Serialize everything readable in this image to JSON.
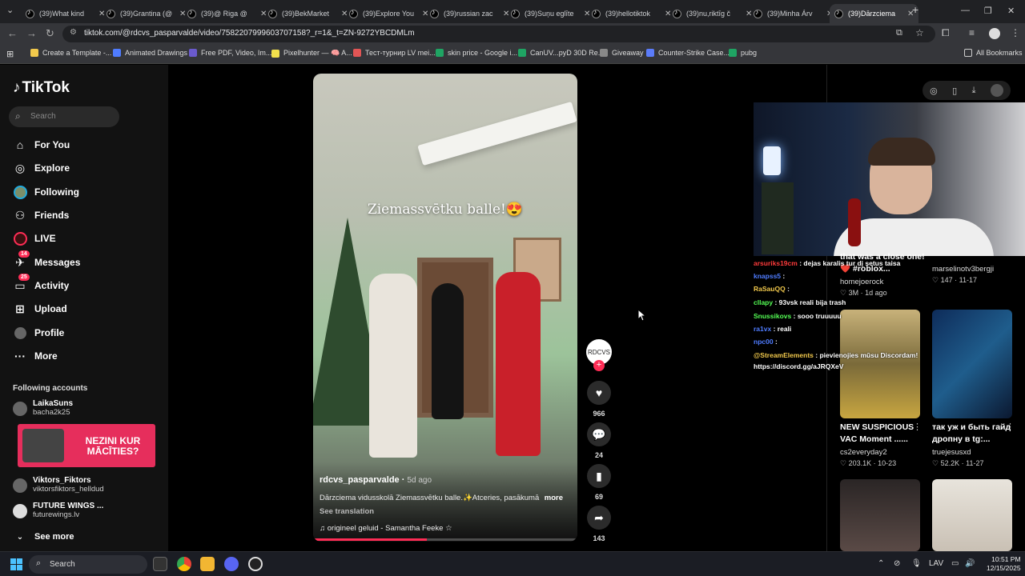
{
  "browser": {
    "tabs": [
      {
        "label": "(39)What kind"
      },
      {
        "label": "(39)Grantina (@"
      },
      {
        "label": "(39)@ Riga @"
      },
      {
        "label": "(39)BekMarket"
      },
      {
        "label": "(39)Explore You"
      },
      {
        "label": "(39)russian zac"
      },
      {
        "label": "(39)Suņu eglīte"
      },
      {
        "label": "(39)hellotiktok"
      },
      {
        "label": "(39)nu,riktīg č"
      },
      {
        "label": "(39)Minha Árv"
      },
      {
        "label": "(39)Dārzciema"
      }
    ],
    "new_tab": "+",
    "url": "tiktok.com/@rdcvs_pasparvalde/video/7582207999603707158?_r=1&_t=ZN-9272YBCDMLm",
    "bookmarks": [
      {
        "label": "Create a Template -...",
        "color": "#f2c94c"
      },
      {
        "label": "Animated Drawings",
        "color": "#4f7cff"
      },
      {
        "label": "Free PDF, Video, Im...",
        "color": "#6a5acd"
      },
      {
        "label": "Pixelhunter — 🧠 A...",
        "color": "#f2e14c"
      },
      {
        "label": "Тест-турнир LV mei...",
        "color": "#e25555"
      },
      {
        "label": "skin price - Google i...",
        "color": "#1fa463"
      },
      {
        "label": "CanUV...pyD 30D Re...",
        "color": "#1fa463"
      },
      {
        "label": "Giveaway",
        "color": "#888888"
      },
      {
        "label": "Counter-Strike Case...",
        "color": "#5b7cfa"
      },
      {
        "label": "pubg",
        "color": "#1fa463"
      }
    ],
    "all_bookmarks": "All Bookmarks"
  },
  "sidebar": {
    "logo": "TikTok",
    "search_placeholder": "Search",
    "nav": [
      {
        "label": "For You",
        "icon": "home-icon"
      },
      {
        "label": "Explore",
        "icon": "compass-icon"
      },
      {
        "label": "Following",
        "icon": "following-avatar-icon"
      },
      {
        "label": "Friends",
        "icon": "friends-icon"
      },
      {
        "label": "LIVE",
        "icon": "live-icon"
      },
      {
        "label": "Messages",
        "icon": "messages-icon",
        "badge": "14"
      },
      {
        "label": "Activity",
        "icon": "activity-icon",
        "badge": "25"
      },
      {
        "label": "Upload",
        "icon": "upload-icon"
      },
      {
        "label": "Profile",
        "icon": "profile-icon"
      },
      {
        "label": "More",
        "icon": "more-icon"
      }
    ],
    "following_header": "Following accounts",
    "accounts": [
      {
        "name": "LaikaSuns",
        "handle": "bacha2k25"
      },
      {
        "name": "Viktors_Fiktors",
        "handle": "viktorsfiktors_helldud"
      },
      {
        "name": "FUTURE WINGS ...",
        "handle": "futurewings.lv"
      }
    ],
    "ad_text": "NEZINI KUR MĀCĪTIES?",
    "see_more": "See more"
  },
  "video": {
    "overlay_text": "Ziemassvētku balle!😍",
    "author": "rdcvs_pasparvalde",
    "age": "5d ago",
    "description": "Dārzciema vidusskolā Ziemassvētku balle.✨Atceries, pasākumā",
    "more": "more",
    "see_translation": "See translation",
    "music": "origineel geluid - Samantha Feeke ☆",
    "progress_fraction": 0.43,
    "likes": "966",
    "comments": "24",
    "saves": "69",
    "shares": "143",
    "creator_avatar_text": "RDCVS",
    "follow_plus": "+"
  },
  "live": {
    "chat": [
      {
        "user": "arsuriks19cm",
        "text": ": dejas karalis tur dį setus taisa",
        "color": "#ff3b3b"
      },
      {
        "user": "knapss5",
        "text": ":",
        "color": "#4f7cff"
      },
      {
        "user": "RaSauQQ",
        "text": ":",
        "color": "#f2c94c"
      },
      {
        "user": "cllapy",
        "text": ": 93vsk reali bija trash",
        "color": "#55ff55"
      },
      {
        "user": "Snussikovs",
        "text": ": sooo truuuuu",
        "color": "#55ff55"
      },
      {
        "user": "ra1vx",
        "text": ": reali",
        "color": "#4f7cff"
      },
      {
        "user": "npc00",
        "text": ":",
        "color": "#4f7cff"
      },
      {
        "user": "@StreamElements",
        "text": ": pievienojies mūsu Discordam!",
        "color": "#f2c94c"
      },
      {
        "user": "",
        "text": "https://discord.gg/aJRQXeV",
        "color": "#ffffff"
      }
    ]
  },
  "feed": [
    {
      "title": "that was a close one! ❤️ #roblox...",
      "author": "homejoerock",
      "likes": "3M",
      "date": "1d ago"
    },
    {
      "title": "",
      "author": "marselinotv3bergji",
      "likes": "147",
      "date": "11-17"
    },
    {
      "title": "NEW SUSPICIOUS VAC Moment ......",
      "author": "cs2everyday2",
      "likes": "203.1K",
      "date": "10-23"
    },
    {
      "title": "так уж и быть гайд дропну в tg:...",
      "author": "truejesusxd",
      "likes": "52.2K",
      "date": "11-27"
    }
  ],
  "taskbar": {
    "search_placeholder": "Search",
    "lang": "LAV",
    "time": "10:51 PM",
    "date": "12/15/2025"
  }
}
